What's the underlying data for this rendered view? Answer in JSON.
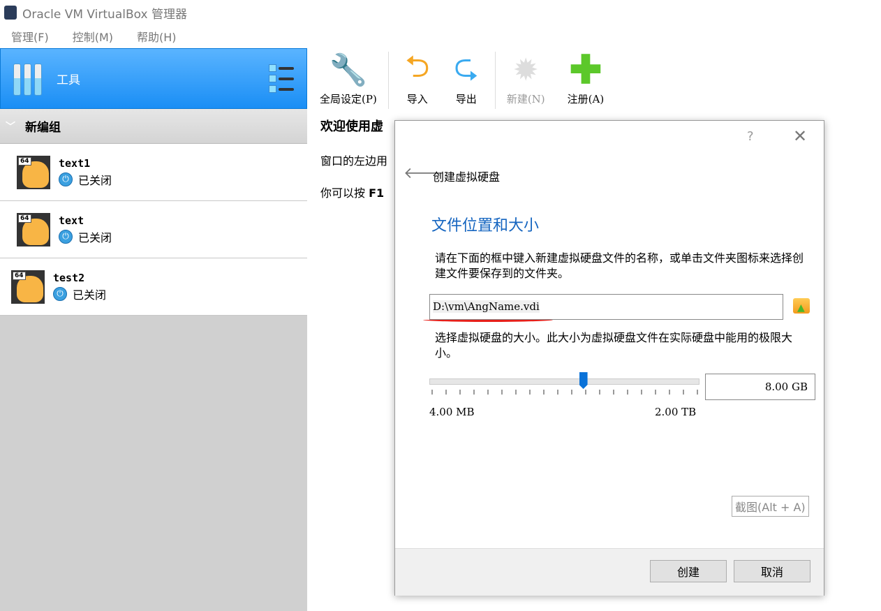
{
  "window": {
    "title": "Oracle VM VirtualBox 管理器"
  },
  "menu": [
    "管理(F)",
    "控制(M)",
    "帮助(H)"
  ],
  "sidebar": {
    "tools_label": "工具",
    "group": "新编组",
    "vms": [
      {
        "name": "text1",
        "state": "已关闭",
        "badge": "64"
      },
      {
        "name": "text",
        "state": "已关闭",
        "badge": "64"
      },
      {
        "name": "test2",
        "state": "已关闭",
        "badge": "64"
      }
    ]
  },
  "toolbar": {
    "settings": "全局设定(P)",
    "import": "导入",
    "export": "导出",
    "new": "新建(N)",
    "register": "注册(A)"
  },
  "welcome": {
    "title": "欢迎使用虚",
    "line1": "窗口的左边用",
    "line2_prefix": "你可以按",
    "line2_key": "F1"
  },
  "dialog": {
    "help": "?",
    "title": "创建虚拟硬盘",
    "section": "文件位置和大小",
    "desc1": "请在下面的框中键入新建虚拟硬盘文件的名称，或单击文件夹图标来选择创建文件要保存到的文件夹。",
    "path": "D:\\vm\\AngName.vdi",
    "desc2": "选择虚拟硬盘的大小。此大小为虚拟硬盘文件在实际硬盘中能用的极限大小。",
    "slider_min": "4.00 MB",
    "slider_max": "2.00 TB",
    "slider_fraction": 0.57,
    "size": "8.00 GB",
    "screenshot_hint": "截图(Alt + A)",
    "create": "创建",
    "cancel": "取消"
  }
}
